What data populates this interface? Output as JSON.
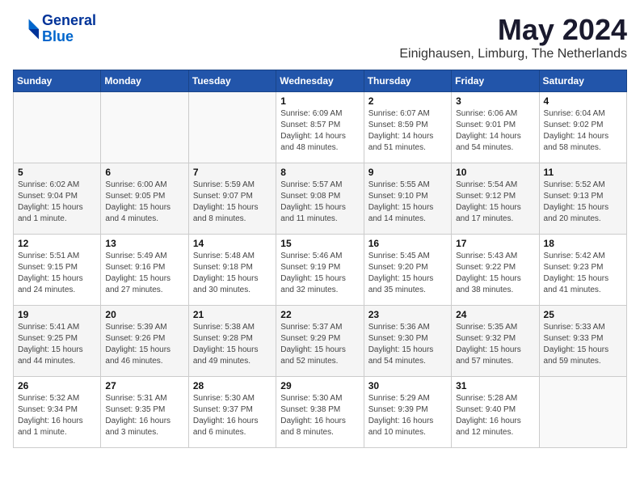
{
  "header": {
    "logo_line1": "General",
    "logo_line2": "Blue",
    "month": "May 2024",
    "location": "Einighausen, Limburg, The Netherlands"
  },
  "weekdays": [
    "Sunday",
    "Monday",
    "Tuesday",
    "Wednesday",
    "Thursday",
    "Friday",
    "Saturday"
  ],
  "weeks": [
    [
      {
        "day": "",
        "info": ""
      },
      {
        "day": "",
        "info": ""
      },
      {
        "day": "",
        "info": ""
      },
      {
        "day": "1",
        "info": "Sunrise: 6:09 AM\nSunset: 8:57 PM\nDaylight: 14 hours\nand 48 minutes."
      },
      {
        "day": "2",
        "info": "Sunrise: 6:07 AM\nSunset: 8:59 PM\nDaylight: 14 hours\nand 51 minutes."
      },
      {
        "day": "3",
        "info": "Sunrise: 6:06 AM\nSunset: 9:01 PM\nDaylight: 14 hours\nand 54 minutes."
      },
      {
        "day": "4",
        "info": "Sunrise: 6:04 AM\nSunset: 9:02 PM\nDaylight: 14 hours\nand 58 minutes."
      }
    ],
    [
      {
        "day": "5",
        "info": "Sunrise: 6:02 AM\nSunset: 9:04 PM\nDaylight: 15 hours\nand 1 minute."
      },
      {
        "day": "6",
        "info": "Sunrise: 6:00 AM\nSunset: 9:05 PM\nDaylight: 15 hours\nand 4 minutes."
      },
      {
        "day": "7",
        "info": "Sunrise: 5:59 AM\nSunset: 9:07 PM\nDaylight: 15 hours\nand 8 minutes."
      },
      {
        "day": "8",
        "info": "Sunrise: 5:57 AM\nSunset: 9:08 PM\nDaylight: 15 hours\nand 11 minutes."
      },
      {
        "day": "9",
        "info": "Sunrise: 5:55 AM\nSunset: 9:10 PM\nDaylight: 15 hours\nand 14 minutes."
      },
      {
        "day": "10",
        "info": "Sunrise: 5:54 AM\nSunset: 9:12 PM\nDaylight: 15 hours\nand 17 minutes."
      },
      {
        "day": "11",
        "info": "Sunrise: 5:52 AM\nSunset: 9:13 PM\nDaylight: 15 hours\nand 20 minutes."
      }
    ],
    [
      {
        "day": "12",
        "info": "Sunrise: 5:51 AM\nSunset: 9:15 PM\nDaylight: 15 hours\nand 24 minutes."
      },
      {
        "day": "13",
        "info": "Sunrise: 5:49 AM\nSunset: 9:16 PM\nDaylight: 15 hours\nand 27 minutes."
      },
      {
        "day": "14",
        "info": "Sunrise: 5:48 AM\nSunset: 9:18 PM\nDaylight: 15 hours\nand 30 minutes."
      },
      {
        "day": "15",
        "info": "Sunrise: 5:46 AM\nSunset: 9:19 PM\nDaylight: 15 hours\nand 32 minutes."
      },
      {
        "day": "16",
        "info": "Sunrise: 5:45 AM\nSunset: 9:20 PM\nDaylight: 15 hours\nand 35 minutes."
      },
      {
        "day": "17",
        "info": "Sunrise: 5:43 AM\nSunset: 9:22 PM\nDaylight: 15 hours\nand 38 minutes."
      },
      {
        "day": "18",
        "info": "Sunrise: 5:42 AM\nSunset: 9:23 PM\nDaylight: 15 hours\nand 41 minutes."
      }
    ],
    [
      {
        "day": "19",
        "info": "Sunrise: 5:41 AM\nSunset: 9:25 PM\nDaylight: 15 hours\nand 44 minutes."
      },
      {
        "day": "20",
        "info": "Sunrise: 5:39 AM\nSunset: 9:26 PM\nDaylight: 15 hours\nand 46 minutes."
      },
      {
        "day": "21",
        "info": "Sunrise: 5:38 AM\nSunset: 9:28 PM\nDaylight: 15 hours\nand 49 minutes."
      },
      {
        "day": "22",
        "info": "Sunrise: 5:37 AM\nSunset: 9:29 PM\nDaylight: 15 hours\nand 52 minutes."
      },
      {
        "day": "23",
        "info": "Sunrise: 5:36 AM\nSunset: 9:30 PM\nDaylight: 15 hours\nand 54 minutes."
      },
      {
        "day": "24",
        "info": "Sunrise: 5:35 AM\nSunset: 9:32 PM\nDaylight: 15 hours\nand 57 minutes."
      },
      {
        "day": "25",
        "info": "Sunrise: 5:33 AM\nSunset: 9:33 PM\nDaylight: 15 hours\nand 59 minutes."
      }
    ],
    [
      {
        "day": "26",
        "info": "Sunrise: 5:32 AM\nSunset: 9:34 PM\nDaylight: 16 hours\nand 1 minute."
      },
      {
        "day": "27",
        "info": "Sunrise: 5:31 AM\nSunset: 9:35 PM\nDaylight: 16 hours\nand 3 minutes."
      },
      {
        "day": "28",
        "info": "Sunrise: 5:30 AM\nSunset: 9:37 PM\nDaylight: 16 hours\nand 6 minutes."
      },
      {
        "day": "29",
        "info": "Sunrise: 5:30 AM\nSunset: 9:38 PM\nDaylight: 16 hours\nand 8 minutes."
      },
      {
        "day": "30",
        "info": "Sunrise: 5:29 AM\nSunset: 9:39 PM\nDaylight: 16 hours\nand 10 minutes."
      },
      {
        "day": "31",
        "info": "Sunrise: 5:28 AM\nSunset: 9:40 PM\nDaylight: 16 hours\nand 12 minutes."
      },
      {
        "day": "",
        "info": ""
      }
    ]
  ]
}
